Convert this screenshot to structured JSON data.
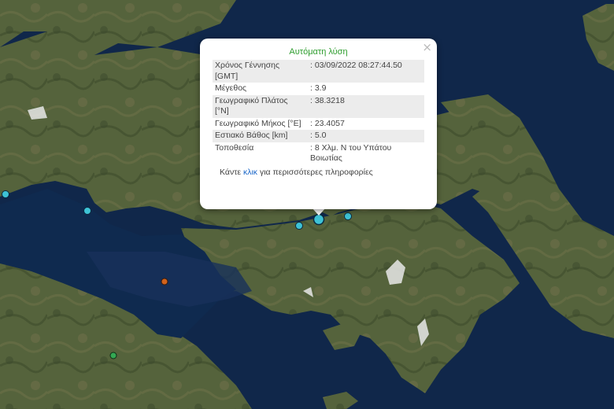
{
  "popup": {
    "close_icon": "×",
    "title": "Αυτόματη λύση",
    "rows": [
      {
        "key": "Χρόνος Γέννησης [GMT]",
        "value": ": 03/09/2022 08:27:44.50"
      },
      {
        "key": "Μέγεθος",
        "value": ": 3.9"
      },
      {
        "key": "Γεωγραφικό Πλάτος [°N]",
        "value": ": 38.3218"
      },
      {
        "key": "Γεωγραφικό Μήκος [°E]",
        "value": ": 23.4057"
      },
      {
        "key": "Εστιακό Βάθος [km]",
        "value": ": 5.0"
      },
      {
        "key": "Τοποθεσία",
        "value": ": 8 Χλμ. Ν του Υπάτου Βοιωτίας"
      }
    ],
    "footer_prefix": "Κάντε ",
    "footer_link": "κλικ",
    "footer_suffix": " για περισσότερες πληροφορίες"
  },
  "colors": {
    "sea": "#10274a",
    "land": "#52603a",
    "quake_recent": "#3ec3d6",
    "quake_orange": "#d2631c",
    "quake_green": "#34a853",
    "popup_title": "#2e9d2e",
    "link": "#1a66c8"
  }
}
